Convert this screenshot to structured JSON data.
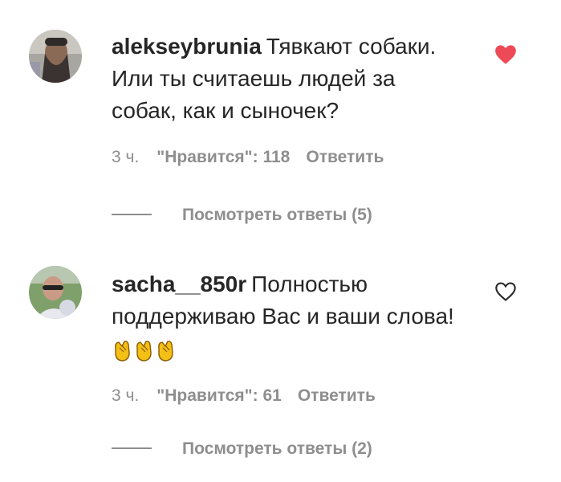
{
  "comments": [
    {
      "username": "alekseybrunia",
      "text": "Тявкают собаки. Или ты считаешь людей за собак, как и сыночек?",
      "time": "3 ч.",
      "likes_label": "\"Нравится\": 118",
      "reply_label": "Ответить",
      "view_replies_label": "Посмотреть ответы (5)",
      "liked": true,
      "heart_icon": "heart-filled-icon"
    },
    {
      "username": "sacha__850r",
      "text": "Полностью поддерживаю Вас и ваши слова!",
      "emoji": "👏👏👏",
      "time": "3 ч.",
      "likes_label": "\"Нравится\": 61",
      "reply_label": "Ответить",
      "view_replies_label": "Посмотреть ответы (2)",
      "liked": false,
      "heart_icon": "heart-outline-icon"
    }
  ],
  "colors": {
    "text": "#262626",
    "secondary": "#8e8e8e",
    "heart_liked": "#ed4956"
  }
}
